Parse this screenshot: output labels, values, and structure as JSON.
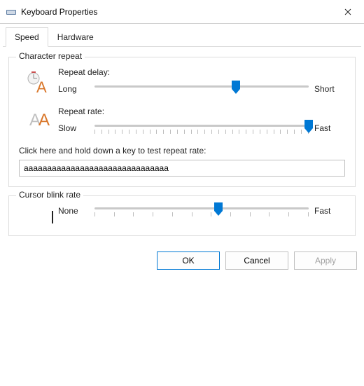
{
  "window": {
    "title": "Keyboard Properties"
  },
  "tabs": {
    "speed": "Speed",
    "hardware": "Hardware",
    "active": "speed"
  },
  "characterRepeat": {
    "legend": "Character repeat",
    "delay": {
      "label": "Repeat delay:",
      "minLabel": "Long",
      "maxLabel": "Short",
      "value": 66,
      "showTicks": false
    },
    "rate": {
      "label": "Repeat rate:",
      "minLabel": "Slow",
      "maxLabel": "Fast",
      "value": 100,
      "showTicks": true,
      "tickCount": 32
    },
    "testLabel": "Click here and hold down a key to test repeat rate:",
    "testValue": "aaaaaaaaaaaaaaaaaaaaaaaaaaaaaaa"
  },
  "cursorBlink": {
    "legend": "Cursor blink rate",
    "minLabel": "None",
    "maxLabel": "Fast",
    "value": 58,
    "showTicks": true,
    "tickCount": 12
  },
  "buttons": {
    "ok": "OK",
    "cancel": "Cancel",
    "apply": "Apply",
    "applyEnabled": false
  }
}
